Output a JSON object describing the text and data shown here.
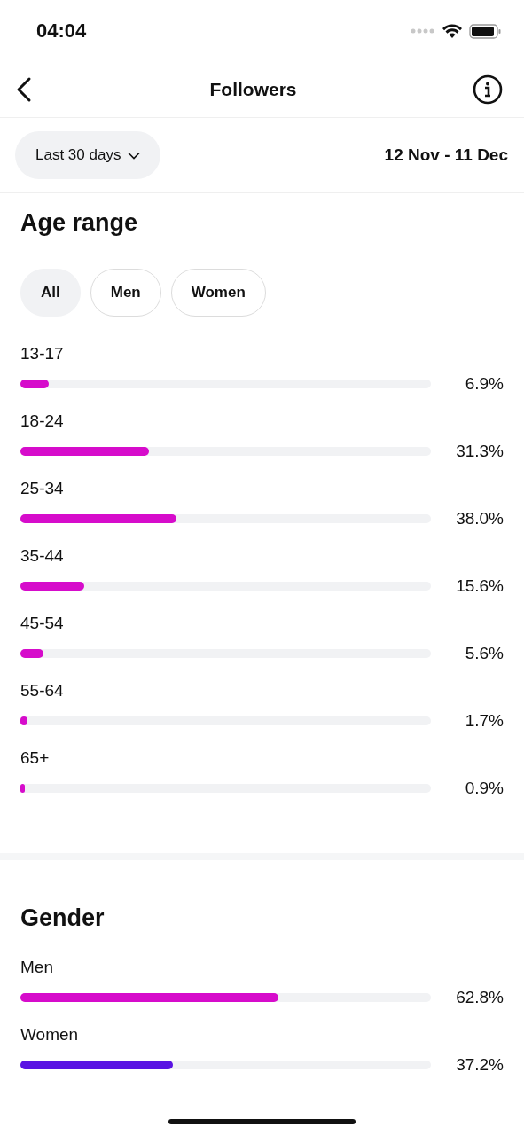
{
  "status_bar": {
    "time": "04:04"
  },
  "header": {
    "title": "Followers"
  },
  "filter": {
    "period": "Last 30 days",
    "date_range": "12 Nov - 11 Dec"
  },
  "age_range": {
    "title": "Age range",
    "chips": [
      {
        "label": "All",
        "selected": true
      },
      {
        "label": "Men",
        "selected": false
      },
      {
        "label": "Women",
        "selected": false
      }
    ],
    "rows": [
      {
        "label": "13-17",
        "level": 0.069,
        "reading": "6.9%"
      },
      {
        "label": "18-24",
        "level": 0.313,
        "reading": "31.3%"
      },
      {
        "label": "25-34",
        "level": 0.38,
        "reading": "38.0%"
      },
      {
        "label": "35-44",
        "level": 0.156,
        "reading": "15.6%"
      },
      {
        "label": "45-54",
        "level": 0.056,
        "reading": "5.6%"
      },
      {
        "label": "55-64",
        "level": 0.017,
        "reading": "1.7%"
      },
      {
        "label": "65+",
        "level": 0.009,
        "reading": "0.9%"
      }
    ]
  },
  "gender": {
    "title": "Gender",
    "rows": [
      {
        "label": "Men",
        "level": 0.628,
        "reading": "62.8%",
        "color": "#d60ccb"
      },
      {
        "label": "Women",
        "level": 0.372,
        "reading": "37.2%",
        "color": "#5a13e3"
      }
    ]
  }
}
